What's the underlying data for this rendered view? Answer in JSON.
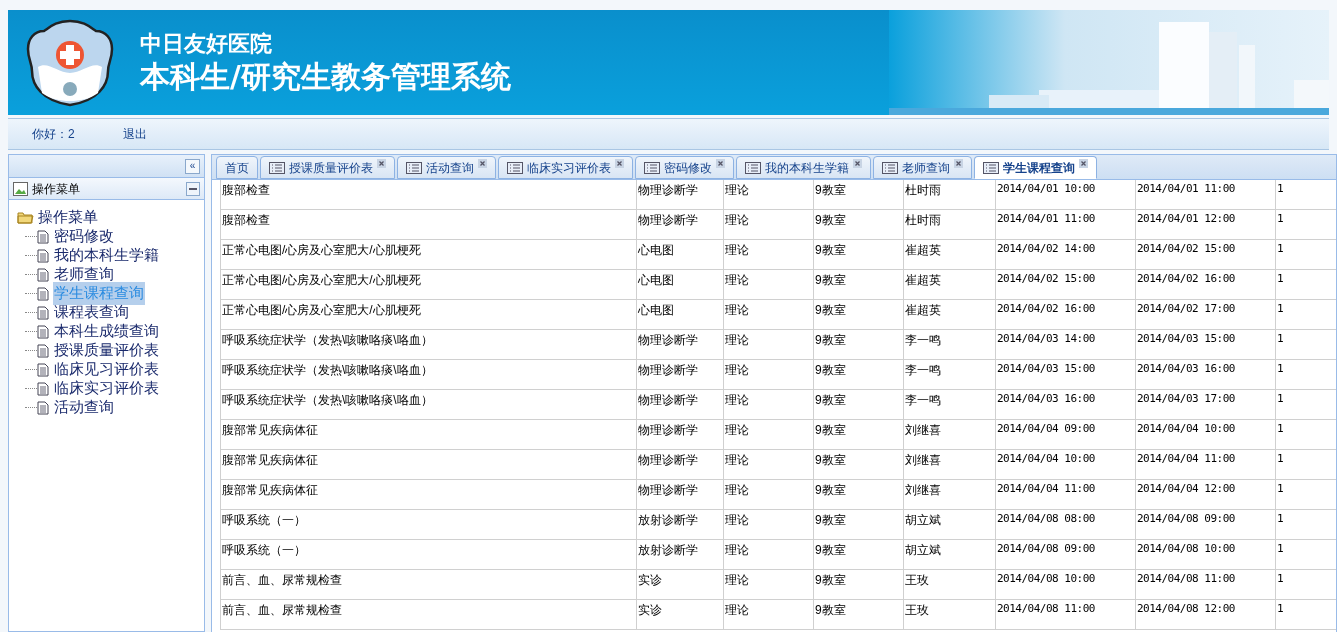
{
  "banner": {
    "hospital": "中日友好医院",
    "system": "本科生/研究生教务管理系统"
  },
  "nav": {
    "greeting": "你好：2",
    "logout": "退出"
  },
  "sidebar": {
    "collapse": "«",
    "title": "操作菜单",
    "tree": {
      "label": "操作菜单",
      "expanded": true,
      "children": [
        {
          "label": "密码修改",
          "selected": false
        },
        {
          "label": "我的本科生学籍",
          "selected": false
        },
        {
          "label": "老师查询",
          "selected": false
        },
        {
          "label": "学生课程查询",
          "selected": true
        },
        {
          "label": "课程表查询",
          "selected": false
        },
        {
          "label": "本科生成绩查询",
          "selected": false
        },
        {
          "label": "授课质量评价表",
          "selected": false
        },
        {
          "label": "临床见习评价表",
          "selected": false
        },
        {
          "label": "临床实习评价表",
          "selected": false
        },
        {
          "label": "活动查询",
          "selected": false
        }
      ]
    }
  },
  "tabs": [
    {
      "label": "首页",
      "closable": false,
      "selected": false
    },
    {
      "label": "授课质量评价表",
      "closable": true,
      "selected": false
    },
    {
      "label": "活动查询",
      "closable": true,
      "selected": false
    },
    {
      "label": "临床实习评价表",
      "closable": true,
      "selected": false
    },
    {
      "label": "密码修改",
      "closable": true,
      "selected": false
    },
    {
      "label": "我的本科生学籍",
      "closable": true,
      "selected": false
    },
    {
      "label": "老师查询",
      "closable": true,
      "selected": false
    },
    {
      "label": "学生课程查询",
      "closable": true,
      "selected": true
    }
  ],
  "table": {
    "rows": [
      [
        "腹部检查",
        "物理诊断学",
        "理论",
        "9教室",
        "杜时雨",
        "2014/04/01 10:00",
        "2014/04/01 11:00",
        "1"
      ],
      [
        "腹部检查",
        "物理诊断学",
        "理论",
        "9教室",
        "杜时雨",
        "2014/04/01 11:00",
        "2014/04/01 12:00",
        "1"
      ],
      [
        "正常心电图/心房及心室肥大/心肌梗死",
        "心电图",
        "理论",
        "9教室",
        "崔超英",
        "2014/04/02 14:00",
        "2014/04/02 15:00",
        "1"
      ],
      [
        "正常心电图/心房及心室肥大/心肌梗死",
        "心电图",
        "理论",
        "9教室",
        "崔超英",
        "2014/04/02 15:00",
        "2014/04/02 16:00",
        "1"
      ],
      [
        "正常心电图/心房及心室肥大/心肌梗死",
        "心电图",
        "理论",
        "9教室",
        "崔超英",
        "2014/04/02 16:00",
        "2014/04/02 17:00",
        "1"
      ],
      [
        "呼吸系统症状学（发热\\咳嗽咯痰\\咯血）",
        "物理诊断学",
        "理论",
        "9教室",
        "李一鸣",
        "2014/04/03 14:00",
        "2014/04/03 15:00",
        "1"
      ],
      [
        "呼吸系统症状学（发热\\咳嗽咯痰\\咯血）",
        "物理诊断学",
        "理论",
        "9教室",
        "李一鸣",
        "2014/04/03 15:00",
        "2014/04/03 16:00",
        "1"
      ],
      [
        "呼吸系统症状学（发热\\咳嗽咯痰\\咯血）",
        "物理诊断学",
        "理论",
        "9教室",
        "李一鸣",
        "2014/04/03 16:00",
        "2014/04/03 17:00",
        "1"
      ],
      [
        "腹部常见疾病体征",
        "物理诊断学",
        "理论",
        "9教室",
        "刘继喜",
        "2014/04/04 09:00",
        "2014/04/04 10:00",
        "1"
      ],
      [
        "腹部常见疾病体征",
        "物理诊断学",
        "理论",
        "9教室",
        "刘继喜",
        "2014/04/04 10:00",
        "2014/04/04 11:00",
        "1"
      ],
      [
        "腹部常见疾病体征",
        "物理诊断学",
        "理论",
        "9教室",
        "刘继喜",
        "2014/04/04 11:00",
        "2014/04/04 12:00",
        "1"
      ],
      [
        "呼吸系统（一）",
        "放射诊断学",
        "理论",
        "9教室",
        "胡立斌",
        "2014/04/08 08:00",
        "2014/04/08 09:00",
        "1"
      ],
      [
        "呼吸系统（一）",
        "放射诊断学",
        "理论",
        "9教室",
        "胡立斌",
        "2014/04/08 09:00",
        "2014/04/08 10:00",
        "1"
      ],
      [
        "前言、血、尿常规检查",
        "实诊",
        "理论",
        "9教室",
        "王玫",
        "2014/04/08 10:00",
        "2014/04/08 11:00",
        "1"
      ],
      [
        "前言、血、尿常规检查",
        "实诊",
        "理论",
        "9教室",
        "王玫",
        "2014/04/08 11:00",
        "2014/04/08 12:00",
        "1"
      ]
    ]
  }
}
